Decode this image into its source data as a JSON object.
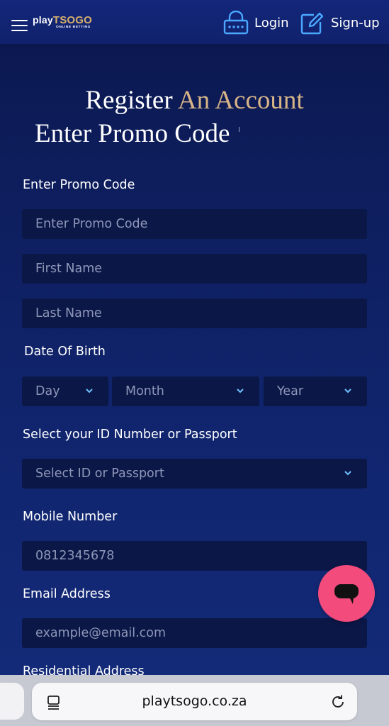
{
  "header": {
    "logo": {
      "prefix": "play",
      "brand": "TSOGO",
      "tagline": "ONLINE BETTING"
    },
    "login_label": "Login",
    "signup_label": "Sign-up"
  },
  "titles": {
    "register_part1": "Register",
    "register_part2": "An Account",
    "promo_heading": "Enter Promo Code"
  },
  "form": {
    "promo_label": "Enter Promo Code",
    "promo_placeholder": "Enter Promo Code",
    "first_name_placeholder": "First Name",
    "last_name_placeholder": "Last Name",
    "dob_label": "Date Of Birth",
    "dob_day": "Day",
    "dob_month": "Month",
    "dob_year": "Year",
    "id_label": "Select your ID Number or Passport",
    "id_placeholder": "Select ID or Passport",
    "mobile_label": "Mobile Number",
    "mobile_placeholder": "0812345678",
    "email_label": "Email Address",
    "email_placeholder": "example@email.com",
    "address_label": "Residential Address"
  },
  "browser": {
    "url": "playtsogo.co.za"
  },
  "colors": {
    "header_bg": "#13267a",
    "page_bg": "#10246c",
    "field_bg": "#0b1747",
    "accent_gold": "#d7b487",
    "chat_button": "#f24b7c",
    "icon_blue": "#4aa8ff"
  },
  "icons": {
    "menu": "hamburger-icon",
    "login": "lock-icon",
    "signup": "pencil-edit-icon",
    "chat": "chat-bubble-icon",
    "reader": "reader-mode-icon",
    "reload": "reload-icon",
    "chevron": "chevron-down-icon"
  }
}
